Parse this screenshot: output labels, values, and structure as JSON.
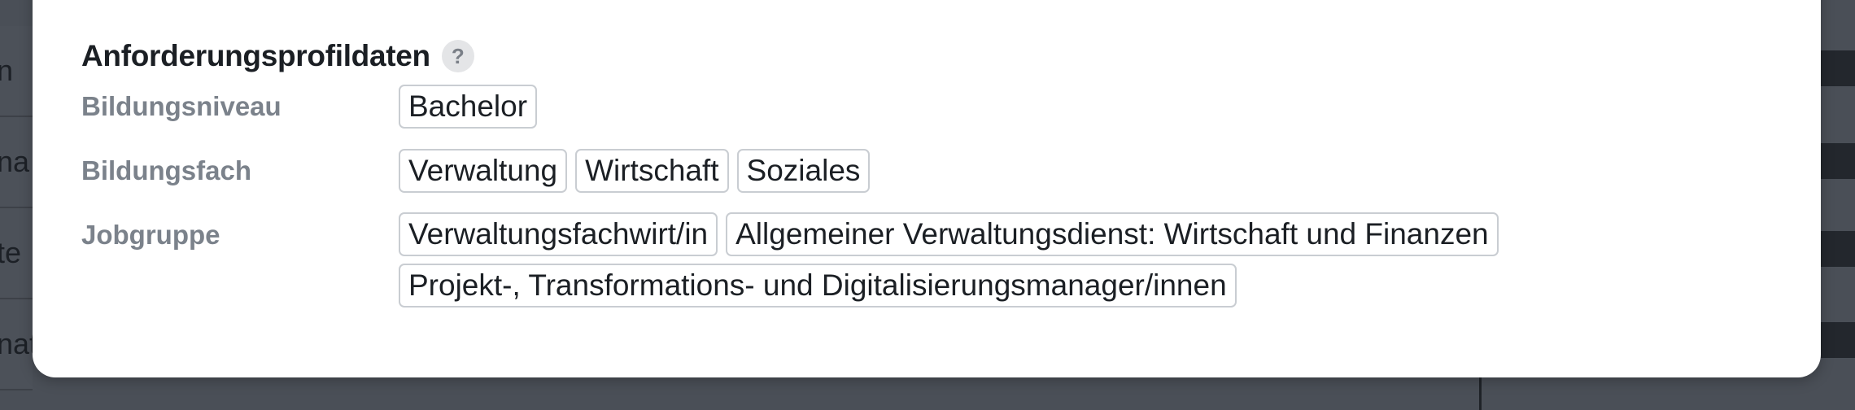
{
  "background": {
    "rows": [
      "n",
      "na",
      "te",
      "nat"
    ]
  },
  "section": {
    "title": "Anforderungsprofildaten",
    "help_symbol": "?"
  },
  "fields": {
    "bildungsniveau": {
      "label": "Bildungsniveau",
      "tags": [
        "Bachelor"
      ]
    },
    "bildungsfach": {
      "label": "Bildungsfach",
      "tags": [
        "Verwaltung",
        "Wirtschaft",
        "Soziales"
      ]
    },
    "jobgruppe": {
      "label": "Jobgruppe",
      "tags": [
        "Verwaltungsfachwirt/in",
        "Allgemeiner Verwaltungsdienst: Wirtschaft und Finanzen",
        "Projekt-, Transformations- und Digitalisierungsmanager/innen"
      ]
    }
  },
  "colors": {
    "overlay": "#4a4f57",
    "title": "#1b1f24",
    "label": "#7b828b",
    "tag_border": "#c9cdd2"
  }
}
